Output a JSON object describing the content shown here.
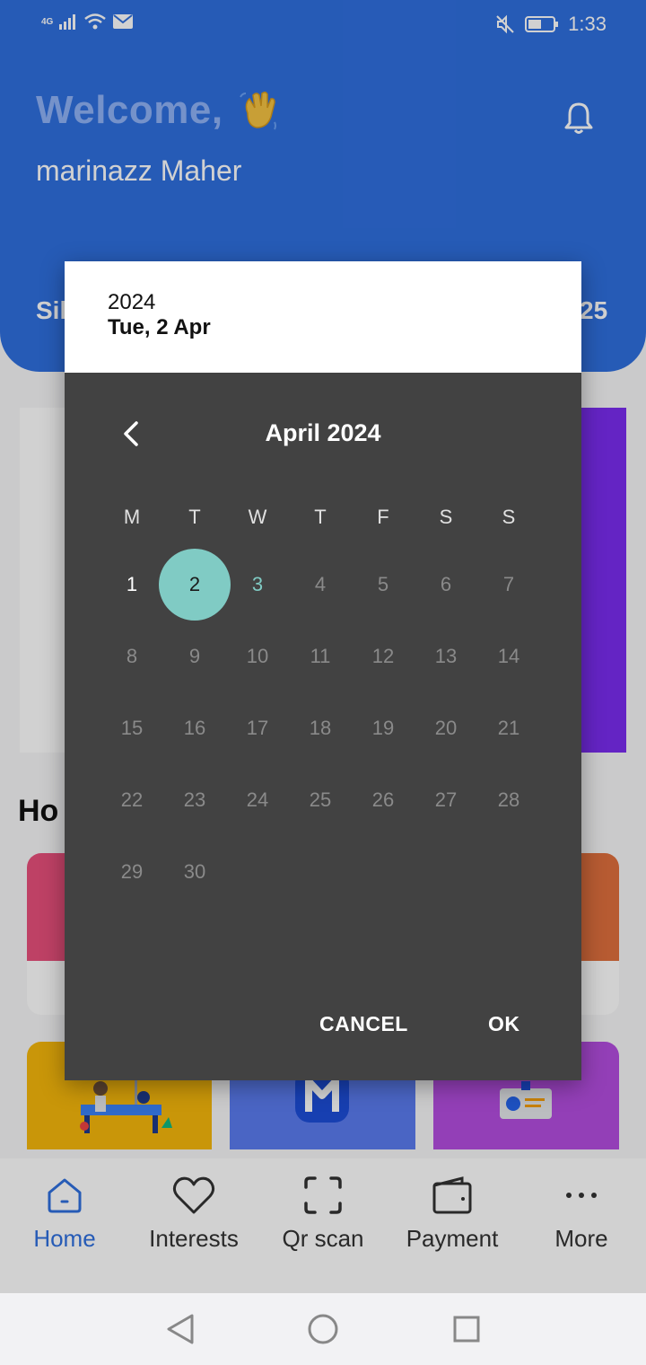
{
  "status_bar": {
    "network": "4G",
    "time": "1:33"
  },
  "header": {
    "welcome": "Welcome,",
    "username": "marinazz Maher",
    "peek_left": "Sil",
    "peek_right": "25"
  },
  "behind": {
    "section_title": "Ho"
  },
  "bottom_nav": {
    "items": [
      {
        "label": "Home",
        "icon": "home-icon",
        "active": true
      },
      {
        "label": "Interests",
        "icon": "heart-icon",
        "active": false
      },
      {
        "label": "Qr scan",
        "icon": "qr-scan-icon",
        "active": false
      },
      {
        "label": "Payment",
        "icon": "wallet-icon",
        "active": false
      },
      {
        "label": "More",
        "icon": "more-dots-icon",
        "active": false
      }
    ]
  },
  "date_picker": {
    "header_year": "2024",
    "header_date": "Tue, 2 Apr",
    "month_title": "April 2024",
    "weekdays": [
      "M",
      "T",
      "W",
      "T",
      "F",
      "S",
      "S"
    ],
    "days": [
      "1",
      "2",
      "3",
      "4",
      "5",
      "6",
      "7",
      "8",
      "9",
      "10",
      "11",
      "12",
      "13",
      "14",
      "15",
      "16",
      "17",
      "18",
      "19",
      "20",
      "21",
      "22",
      "23",
      "24",
      "25",
      "26",
      "27",
      "28",
      "29",
      "30"
    ],
    "first_weekday_index": 0,
    "selected_day": "2",
    "today_day": "3",
    "enabled_days": [
      "1",
      "2",
      "3"
    ],
    "cancel_label": "CANCEL",
    "ok_label": "OK"
  },
  "colors": {
    "primary": "#2f6fdf",
    "dialog_bg": "#424242",
    "accent_teal": "#80cbc4"
  }
}
